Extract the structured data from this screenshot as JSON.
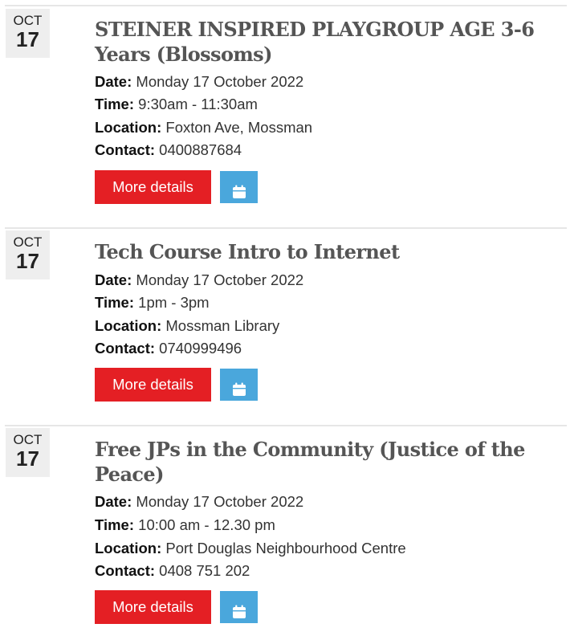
{
  "events": [
    {
      "date_month": "OCT",
      "date_day": "17",
      "title": "STEINER INSPIRED PLAYGROUP AGE 3-6 Years (Blossoms)",
      "date_label": "Date:",
      "date_value": "Monday 17 October 2022",
      "time_label": "Time:",
      "time_value": "9:30am - 11:30am",
      "location_label": "Location:",
      "location_value": "Foxton Ave, Mossman",
      "contact_label": "Contact:",
      "contact_value": "0400887684",
      "more_label": "More details",
      "calendar_icon": "calendar-icon"
    },
    {
      "date_month": "OCT",
      "date_day": "17",
      "title": "Tech Course Intro to Internet",
      "date_label": "Date:",
      "date_value": "Monday 17 October 2022",
      "time_label": "Time:",
      "time_value": "1pm - 3pm",
      "location_label": "Location:",
      "location_value": "Mossman Library",
      "contact_label": "Contact:",
      "contact_value": "0740999496",
      "more_label": "More details",
      "calendar_icon": "calendar-icon"
    },
    {
      "date_month": "OCT",
      "date_day": "17",
      "title": "Free JPs in the Community (Justice of the Peace)",
      "date_label": "Date:",
      "date_value": "Monday 17 October 2022",
      "time_label": "Time:",
      "time_value": "10:00 am - 12.30 pm",
      "location_label": "Location:",
      "location_value": "Port Douglas Neighbourhood Centre",
      "contact_label": "Contact:",
      "contact_value": "0408 751 202",
      "more_label": "More details",
      "calendar_icon": "calendar-icon"
    }
  ],
  "colors": {
    "more_button": "#e41f24",
    "calendar_button": "#4aa7dc",
    "title": "#555555",
    "badge_bg": "#eeeeee"
  }
}
